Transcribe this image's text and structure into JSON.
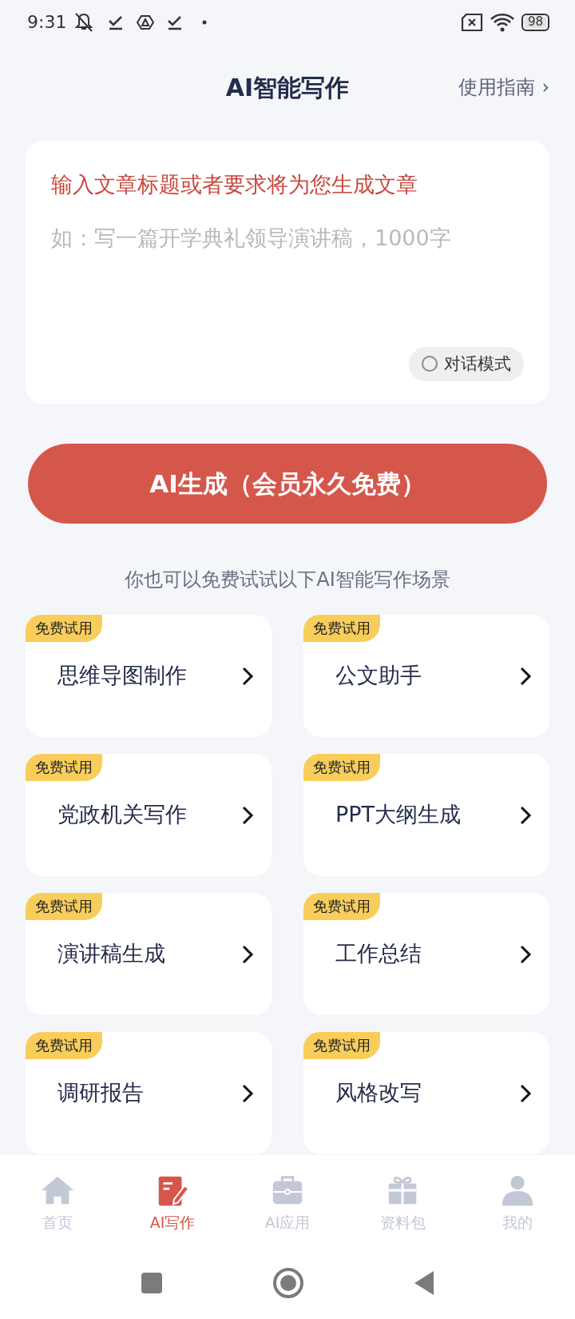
{
  "status_bar": {
    "time": "9:31",
    "battery": "98"
  },
  "header": {
    "title": "AI智能写作",
    "guide_link": "使用指南",
    "guide_arrow": "›"
  },
  "prompt_card": {
    "heading": "输入文章标题或者要求将为您生成文章",
    "placeholder": "如：写一篇开学典礼领导演讲稿，1000字",
    "dialog_mode": {
      "label": "对话模式",
      "checked": false
    }
  },
  "generate_button": "AI生成（会员永久免费）",
  "scenes_caption": "你也可以免费试试以下AI智能写作场景",
  "scenes": [
    {
      "badge": "免费试用",
      "title": "思维导图制作"
    },
    {
      "badge": "免费试用",
      "title": "公文助手"
    },
    {
      "badge": "免费试用",
      "title": "党政机关写作"
    },
    {
      "badge": "免费试用",
      "title": "PPT大纲生成"
    },
    {
      "badge": "免费试用",
      "title": "演讲稿生成"
    },
    {
      "badge": "免费试用",
      "title": "工作总结"
    },
    {
      "badge": "免费试用",
      "title": "调研报告"
    },
    {
      "badge": "免费试用",
      "title": "风格改写"
    }
  ],
  "bottom_nav": [
    {
      "kind": "home",
      "label": "首页",
      "selected": false
    },
    {
      "kind": "write",
      "label": "AI写作",
      "selected": true
    },
    {
      "kind": "apps",
      "label": "AI应用",
      "selected": false
    },
    {
      "kind": "gift",
      "label": "资料包",
      "selected": false
    },
    {
      "kind": "user",
      "label": "我的",
      "selected": false
    }
  ]
}
